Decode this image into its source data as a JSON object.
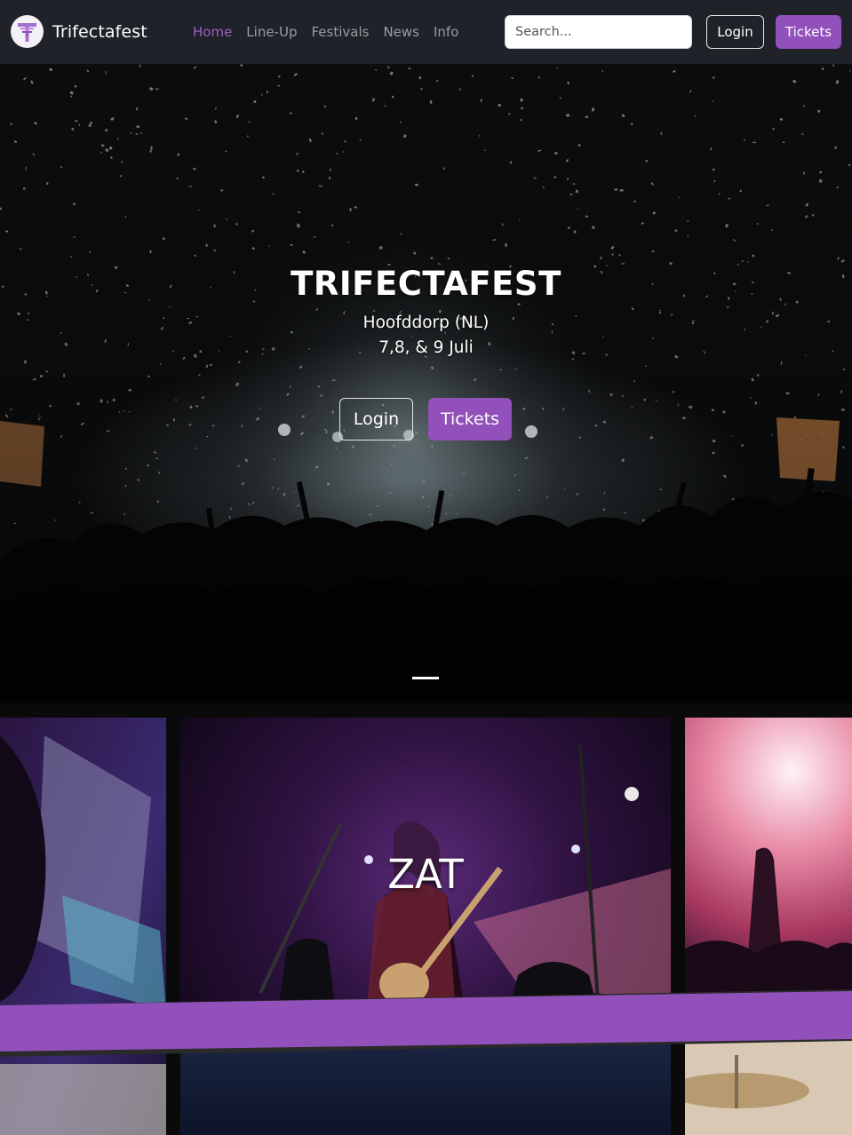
{
  "navbar": {
    "brand_name": "Trifectafest",
    "links": [
      "Home",
      "Line-Up",
      "Festivals",
      "News",
      "Info"
    ],
    "active_link": "Home",
    "search_placeholder": "Search...",
    "login_label": "Login",
    "tickets_label": "Tickets"
  },
  "hero": {
    "title": "TRIFECTAFEST",
    "location": "Hoofddorp (NL)",
    "dates": "7,8, & 9 Juli",
    "login_label": "Login",
    "tickets_label": "Tickets"
  },
  "gallery": {
    "featured_artist": "ZAT"
  },
  "colors": {
    "accent": "#9150ba",
    "navbar_bg": "#1f2228",
    "active_link": "#9b5fc7"
  },
  "icons": {
    "brand_logo": "trifecta-t-logo"
  }
}
